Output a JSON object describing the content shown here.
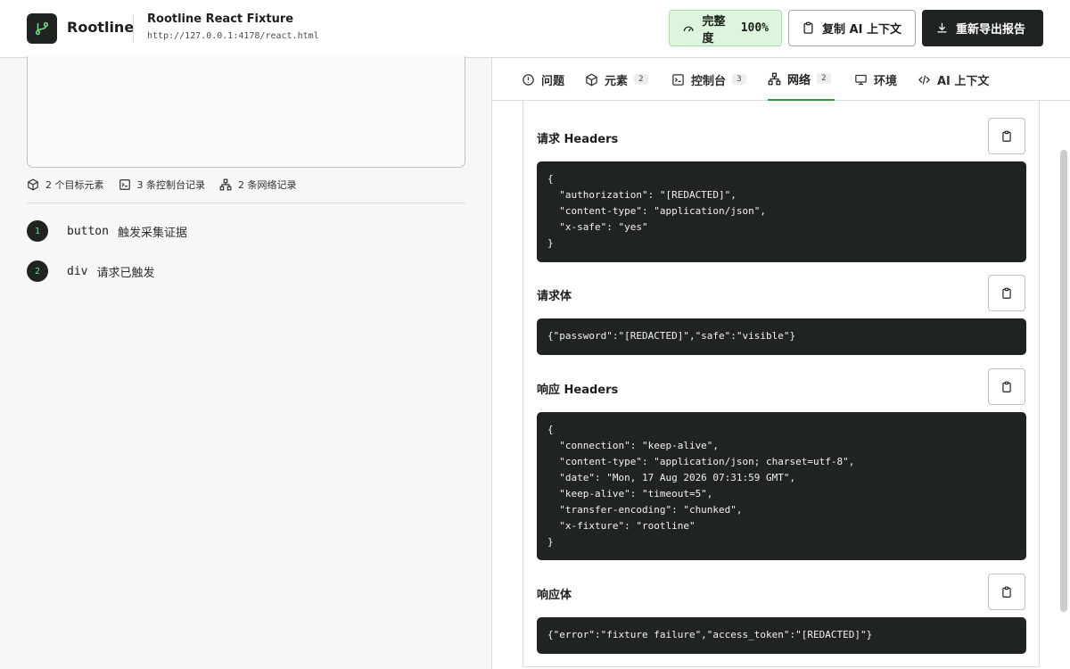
{
  "header": {
    "brand": "Rootline",
    "fixture_title": "Rootline React Fixture",
    "fixture_url": "http://127.0.0.1:4178/react.html",
    "completeness_label": "完整度",
    "completeness_value": "100%",
    "copy_ai_label": "复制 AI 上下文",
    "export_label": "重新导出报告"
  },
  "left": {
    "stats": [
      {
        "icon": "cube-icon",
        "label": "2 个目标元素"
      },
      {
        "icon": "terminal-icon",
        "label": "3 条控制台记录"
      },
      {
        "icon": "network-icon",
        "label": "2 条网络记录"
      }
    ],
    "elements": [
      {
        "num": "1",
        "tag": "button",
        "text": "触发采集证据"
      },
      {
        "num": "2",
        "tag": "div",
        "text": "请求已触发"
      }
    ]
  },
  "tabs": [
    {
      "label": "问题",
      "badge": "",
      "icon": "alert-circle-icon"
    },
    {
      "label": "元素",
      "badge": "2",
      "icon": "cube-icon"
    },
    {
      "label": "控制台",
      "badge": "3",
      "icon": "terminal-icon"
    },
    {
      "label": "网络",
      "badge": "2",
      "icon": "network-icon",
      "active": true
    },
    {
      "label": "环境",
      "badge": "",
      "icon": "monitor-icon"
    },
    {
      "label": "AI 上下文",
      "badge": "",
      "icon": "code-icon"
    }
  ],
  "network": {
    "request_headers_label": "请求 Headers",
    "request_headers": "{\n  \"authorization\": \"[REDACTED]\",\n  \"content-type\": \"application/json\",\n  \"x-safe\": \"yes\"\n}",
    "request_body_label": "请求体",
    "request_body": "{\"password\":\"[REDACTED]\",\"safe\":\"visible\"}",
    "response_headers_label": "响应 Headers",
    "response_headers": "{\n  \"connection\": \"keep-alive\",\n  \"content-type\": \"application/json; charset=utf-8\",\n  \"date\": \"Mon, 17 Aug 2026 07:31:59 GMT\",\n  \"keep-alive\": \"timeout=5\",\n  \"transfer-encoding\": \"chunked\",\n  \"x-fixture\": \"rootline\"\n}",
    "response_body_label": "响应体",
    "response_body": "{\"error\":\"fixture failure\",\"access_token\":\"[REDACTED]\"}"
  },
  "colors": {
    "accent": "#2a9d4a",
    "dark": "#1f2420",
    "complete_bg": "#dcf5dc"
  }
}
